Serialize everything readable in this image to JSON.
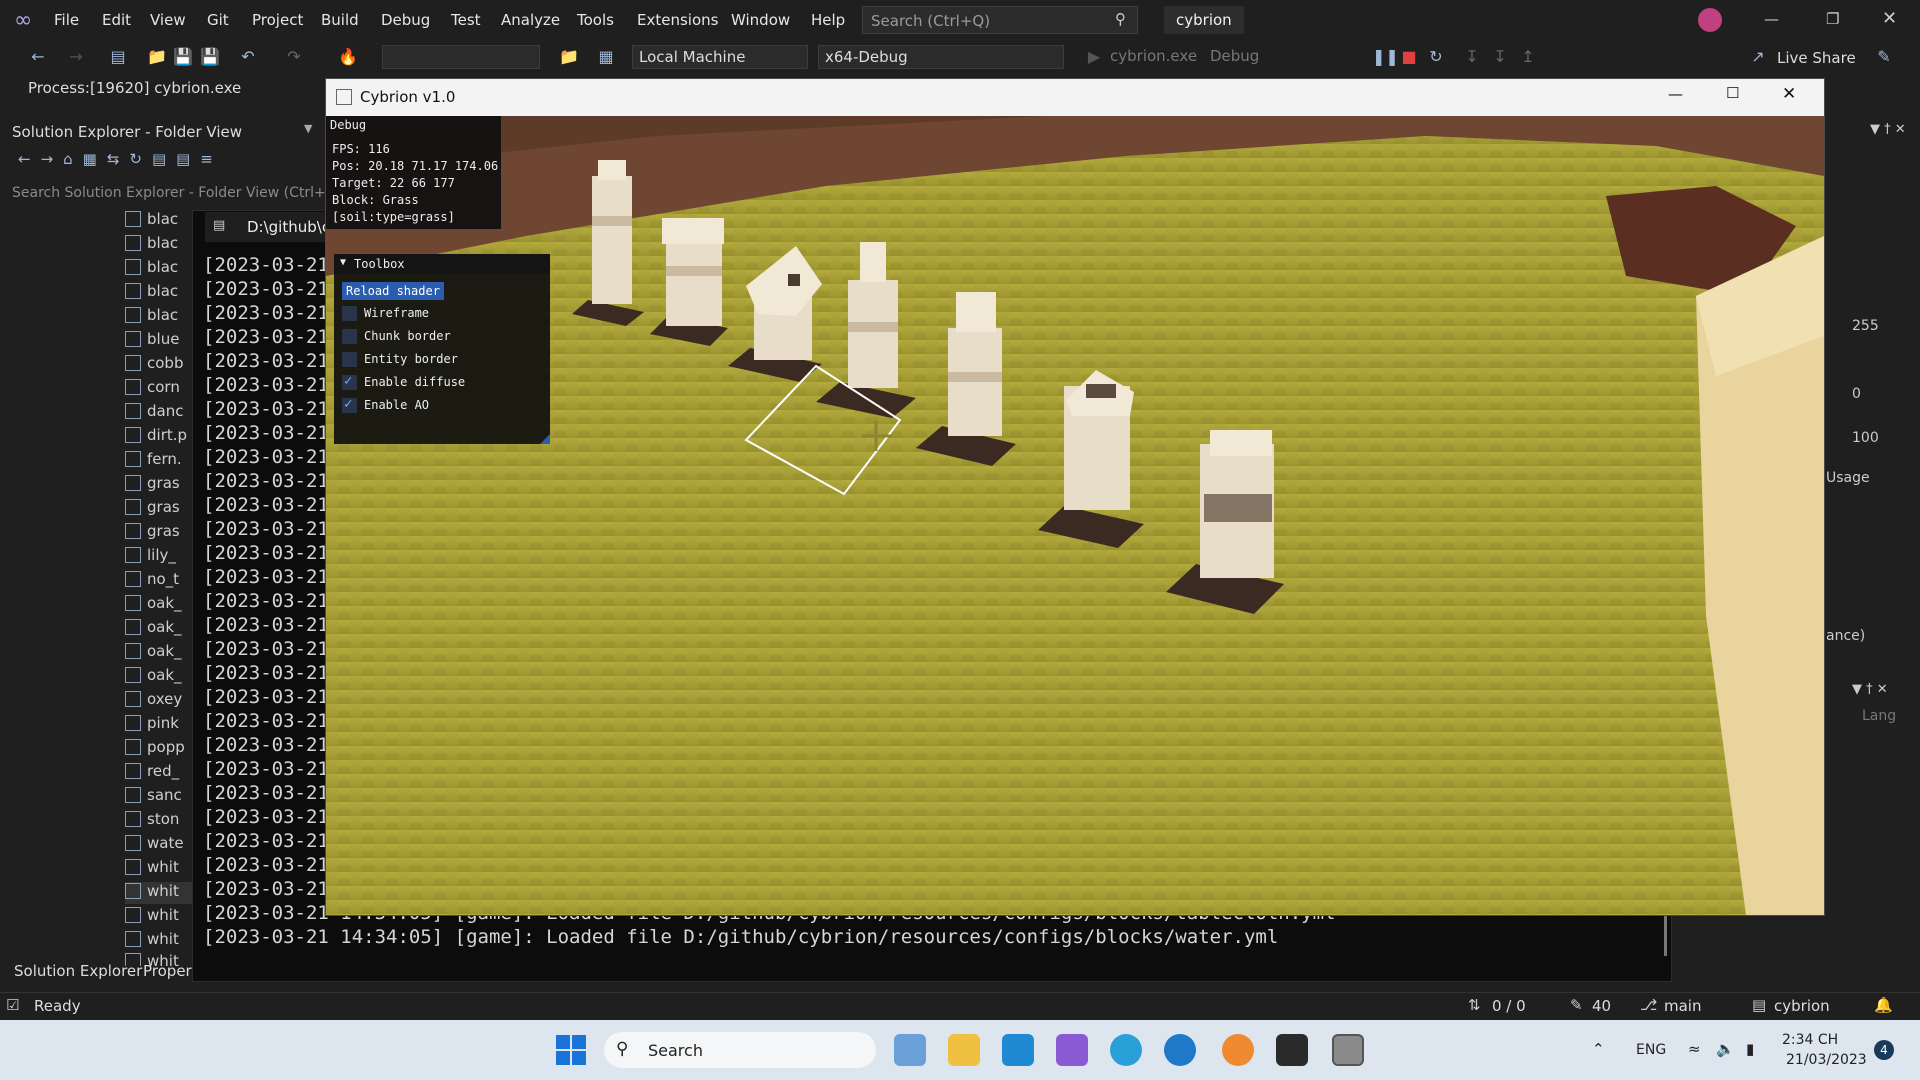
{
  "menubar": {
    "items": [
      "File",
      "Edit",
      "View",
      "Git",
      "Project",
      "Build",
      "Debug",
      "Test",
      "Analyze",
      "Tools",
      "Extensions",
      "Window",
      "Help"
    ],
    "search_placeholder": "Search (Ctrl+Q)",
    "solution_name": "cybrion"
  },
  "toolbar": {
    "target": "Local Machine",
    "config": "x64-Debug",
    "run_target": "cybrion.exe",
    "run_config": "Debug",
    "live_share": "Live Share"
  },
  "process": {
    "label": "Process:",
    "value": "[19620] cybrion.exe"
  },
  "solution_explorer": {
    "title": "Solution Explorer - Folder View",
    "search_placeholder": "Search Solution Explorer - Folder View (Ctrl+;)",
    "items": [
      "blac",
      "blac",
      "blac",
      "blac",
      "blac",
      "blue",
      "cobb",
      "corn",
      "danc",
      "dirt.p",
      "fern.",
      "gras",
      "gras",
      "gras",
      "lily_",
      "no_t",
      "oak_",
      "oak_",
      "oak_",
      "oak_",
      "oxey",
      "pink",
      "popp",
      "red_",
      "sanc",
      "ston",
      "wate",
      "whit",
      "whit",
      "whit",
      "whit",
      "whit"
    ],
    "tabs": [
      "Solution Explorer",
      "Propert"
    ]
  },
  "console": {
    "title": "D:\\github\\c",
    "truncated_prefix": "[2023-03-21",
    "line_second_last": "[2023-03-21 14:34:05] [game]: Loaded file D:/github/cybrion/resources/configs/blocks/tablecloth.yml",
    "line_last": "[2023-03-21 14:34:05] [game]: Loaded file D:/github/cybrion/resources/configs/blocks/water.yml"
  },
  "right_panel": {
    "v1": "255",
    "v2": "0",
    "v3": "100",
    "usage": "Usage",
    "ance": "ance)",
    "lang": "Lang"
  },
  "statusbar": {
    "ready": "Ready",
    "changes": "0 / 0",
    "edits": "40",
    "branch": "main",
    "repo": "cybrion"
  },
  "taskbar": {
    "search": "Search",
    "lang": "ENG",
    "time": "2:34 CH",
    "date": "21/03/2023",
    "notif": "4"
  },
  "game": {
    "title": "Cybrion v1.0",
    "debug": {
      "header": "Debug",
      "fps": "FPS: 116",
      "pos": "Pos: 20.18 71.17 174.06",
      "target": "Target: 22 66 177",
      "block": "Block: Grass",
      "state": "[soil:type=grass]"
    },
    "toolbox": {
      "header": "Toolbox",
      "reload": "Reload shader",
      "options": [
        {
          "label": "Wireframe",
          "checked": false
        },
        {
          "label": "Chunk border",
          "checked": false
        },
        {
          "label": "Entity border",
          "checked": false
        },
        {
          "label": "Enable diffuse",
          "checked": true
        },
        {
          "label": "Enable AO",
          "checked": true
        }
      ]
    }
  },
  "colors": {
    "accent": "#007acc",
    "grass": "#a39c34",
    "dirt": "#6b3a2a",
    "sand": "#e6cf9a"
  }
}
